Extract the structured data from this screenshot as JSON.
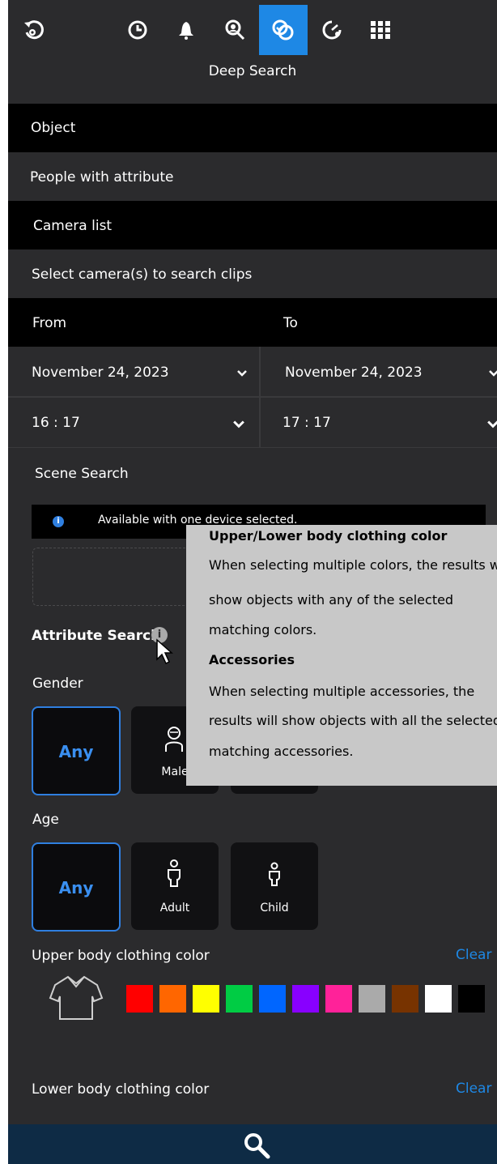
{
  "header": {
    "title": "Deep Search"
  },
  "toolbar": {
    "icons": [
      "back-icon",
      "clock-icon",
      "bell-icon",
      "face-search-icon",
      "deep-search-icon",
      "speedometer-icon",
      "grid-icon"
    ],
    "active_index": 4,
    "active_color": "#1e88e5"
  },
  "object": {
    "label": "Object",
    "value": "People with attribute"
  },
  "camera_list": {
    "label": "Camera list",
    "value": "Select camera(s) to search clips"
  },
  "time_range": {
    "from_label": "From",
    "to_label": "To",
    "from_date": "November 24, 2023",
    "to_date": "November 24, 2023",
    "from_time": "16 : 17",
    "to_time": "17 : 17"
  },
  "scene_search": {
    "label": "Scene Search",
    "info": "Available with one device selected."
  },
  "attribute_search": {
    "label": "Attribute Search"
  },
  "gender": {
    "label": "Gender",
    "options": [
      "Any",
      "Male"
    ],
    "selected": "Any"
  },
  "age": {
    "label": "Age",
    "options": [
      "Any",
      "Adult",
      "Child"
    ],
    "selected": "Any"
  },
  "upper_color": {
    "label": "Upper body clothing color",
    "clear_label": "Clear",
    "colors": [
      "#ff0000",
      "#ff6600",
      "#ffff00",
      "#00cc44",
      "#0066ff",
      "#8800ff",
      "#ff2299",
      "#aaaaaa",
      "#773300",
      "#ffffff",
      "#000000"
    ]
  },
  "lower_color": {
    "label": "Lower body clothing color",
    "clear_label": "Clear"
  },
  "tooltip": {
    "heading1": "Upper/Lower body clothing color",
    "line1": "When selecting multiple colors, the results wil",
    "line2": "show objects with any of the selected",
    "line3": "matching colors.",
    "heading2": "Accessories",
    "line4": "When selecting multiple accessories, the",
    "line5": "results will show objects with all the selected",
    "line6": "matching accessories."
  }
}
